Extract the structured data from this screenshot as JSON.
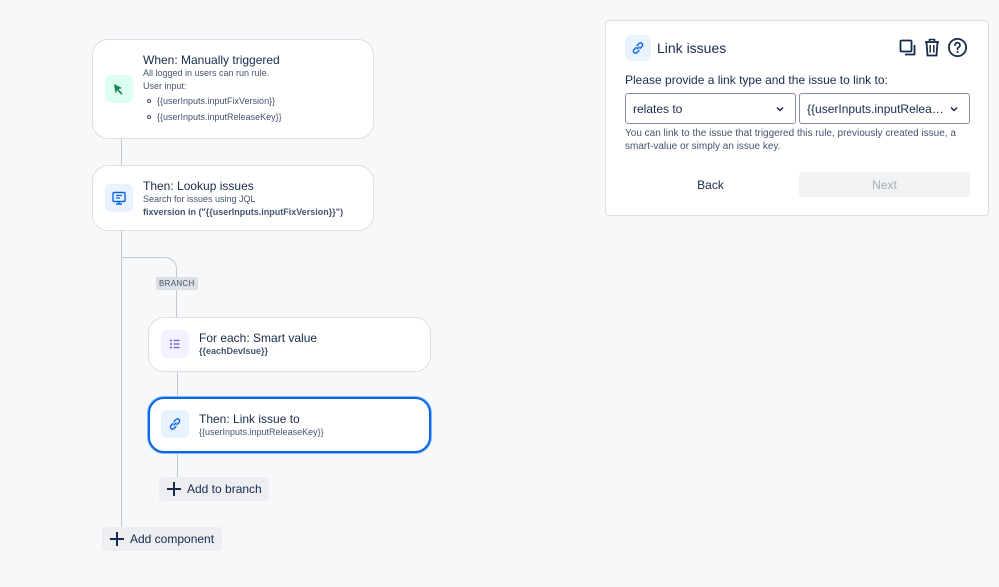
{
  "flow": {
    "trigger": {
      "title": "When: Manually triggered",
      "line1": "All logged in users can run rule.",
      "line2": "User input:",
      "inputs": [
        "{{userInputs.inputFixVersion}}",
        "{{userInputs.inputReleaseKey}}"
      ]
    },
    "lookup": {
      "title": "Then: Lookup issues",
      "line1": "Search for issues using JQL",
      "jql": "fixversion in (\"{{userInputs.inputFixVersion}}\")"
    },
    "branch_label": "BRANCH",
    "foreach": {
      "title": "For each: Smart value",
      "value": "{{eachDevIsue}}"
    },
    "link": {
      "title": "Then: Link issue to",
      "value": "{{userInputs.inputReleaseKey}}"
    },
    "add_to_branch": "Add to branch",
    "add_component": "Add component"
  },
  "panel": {
    "title": "Link issues",
    "prompt": "Please provide a link type and the issue to link to:",
    "link_type": "relates to",
    "issue": "{{userInputs.inputRelea…",
    "help": "You can link to the issue that triggered this rule, previously created issue, a smart-value or simply an issue key.",
    "back": "Back",
    "next": "Next"
  },
  "colors": {
    "accent": "#0c66e4",
    "trigger_icon": "#22a06b",
    "lookup_icon": "#1d7afc",
    "foreach_icon": "#8f7ee7"
  }
}
